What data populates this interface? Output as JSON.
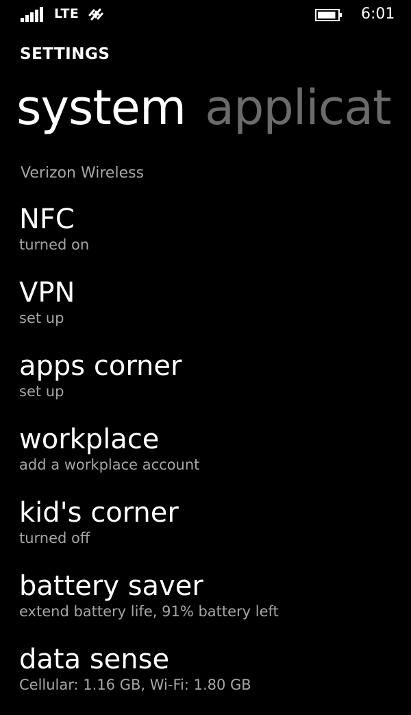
{
  "status_bar": {
    "network_type": "LTE",
    "time": "6:01",
    "signal_icon": "signal-strength-icon",
    "data_icon": "data-transfer-icon",
    "battery_icon": "battery-icon",
    "battery_level": 0.91
  },
  "app": {
    "title": "SETTINGS"
  },
  "pivot": {
    "items": [
      {
        "label": "system",
        "active": true
      },
      {
        "label": "applicat",
        "active": false
      }
    ]
  },
  "carrier": "Verizon Wireless",
  "settings": [
    {
      "title": "NFC",
      "subtitle": "turned on"
    },
    {
      "title": "VPN",
      "subtitle": "set up"
    },
    {
      "title": "apps corner",
      "subtitle": "set up"
    },
    {
      "title": "workplace",
      "subtitle": "add a workplace account"
    },
    {
      "title": "kid's corner",
      "subtitle": "turned off"
    },
    {
      "title": "battery saver",
      "subtitle": "extend battery life, 91% battery left"
    },
    {
      "title": "data sense",
      "subtitle": "Cellular: 1.16 GB, Wi-Fi: 1.80 GB"
    }
  ],
  "colors": {
    "background": "#000000",
    "text_primary": "#ffffff",
    "text_secondary": "#a6a6a6",
    "pivot_inactive": "#6b6b6b"
  }
}
